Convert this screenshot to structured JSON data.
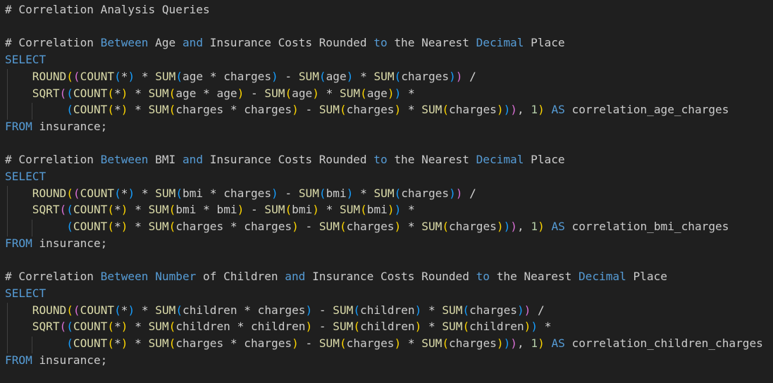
{
  "editor": {
    "language": "SQL",
    "colors": {
      "background": "#1f1f1f",
      "default": "#cccccc",
      "keyword": "#569cd6",
      "function": "#dcdcaa",
      "number": "#b5cea8",
      "bracket_level_1": "#ffd700",
      "bracket_level_2": "#da70d6",
      "bracket_level_3": "#179fff",
      "indent_guide": "#404040"
    },
    "lines": [
      [
        [
          "com",
          "# Correlation Analysis Queries"
        ]
      ],
      [],
      [
        [
          "com",
          "# Correlation "
        ],
        [
          "kw",
          "Between"
        ],
        [
          "com",
          " Age "
        ],
        [
          "kw",
          "and"
        ],
        [
          "com",
          " Insurance Costs Rounded "
        ],
        [
          "kw",
          "to"
        ],
        [
          "com",
          " the Nearest "
        ],
        [
          "kw",
          "Decimal"
        ],
        [
          "com",
          " Place"
        ]
      ],
      [
        [
          "kw",
          "SELECT"
        ]
      ],
      [
        [
          "pl",
          "    "
        ],
        [
          "fn",
          "ROUND"
        ],
        [
          "b1",
          "("
        ],
        [
          "b2",
          "("
        ],
        [
          "fn",
          "COUNT"
        ],
        [
          "b3",
          "("
        ],
        [
          "op",
          "*"
        ],
        [
          "b3",
          ")"
        ],
        [
          "op",
          " * "
        ],
        [
          "fn",
          "SUM"
        ],
        [
          "b3",
          "("
        ],
        [
          "pl",
          "age "
        ],
        [
          "op",
          "*"
        ],
        [
          "pl",
          " charges"
        ],
        [
          "b3",
          ")"
        ],
        [
          "op",
          " - "
        ],
        [
          "fn",
          "SUM"
        ],
        [
          "b3",
          "("
        ],
        [
          "pl",
          "age"
        ],
        [
          "b3",
          ")"
        ],
        [
          "op",
          " * "
        ],
        [
          "fn",
          "SUM"
        ],
        [
          "b3",
          "("
        ],
        [
          "pl",
          "charges"
        ],
        [
          "b3",
          ")"
        ],
        [
          "b2",
          ")"
        ],
        [
          "op",
          " /"
        ]
      ],
      [
        [
          "pl",
          "    "
        ],
        [
          "fn",
          "SQRT"
        ],
        [
          "b2",
          "("
        ],
        [
          "b3",
          "("
        ],
        [
          "fn",
          "COUNT"
        ],
        [
          "b1",
          "("
        ],
        [
          "op",
          "*"
        ],
        [
          "b1",
          ")"
        ],
        [
          "op",
          " * "
        ],
        [
          "fn",
          "SUM"
        ],
        [
          "b1",
          "("
        ],
        [
          "pl",
          "age "
        ],
        [
          "op",
          "*"
        ],
        [
          "pl",
          " age"
        ],
        [
          "b1",
          ")"
        ],
        [
          "op",
          " - "
        ],
        [
          "fn",
          "SUM"
        ],
        [
          "b1",
          "("
        ],
        [
          "pl",
          "age"
        ],
        [
          "b1",
          ")"
        ],
        [
          "op",
          " * "
        ],
        [
          "fn",
          "SUM"
        ],
        [
          "b1",
          "("
        ],
        [
          "pl",
          "age"
        ],
        [
          "b1",
          ")"
        ],
        [
          "b3",
          ")"
        ],
        [
          "op",
          " *"
        ]
      ],
      [
        [
          "pl",
          "         "
        ],
        [
          "b3",
          "("
        ],
        [
          "fn",
          "COUNT"
        ],
        [
          "b1",
          "("
        ],
        [
          "op",
          "*"
        ],
        [
          "b1",
          ")"
        ],
        [
          "op",
          " * "
        ],
        [
          "fn",
          "SUM"
        ],
        [
          "b1",
          "("
        ],
        [
          "pl",
          "charges "
        ],
        [
          "op",
          "*"
        ],
        [
          "pl",
          " charges"
        ],
        [
          "b1",
          ")"
        ],
        [
          "op",
          " - "
        ],
        [
          "fn",
          "SUM"
        ],
        [
          "b1",
          "("
        ],
        [
          "pl",
          "charges"
        ],
        [
          "b1",
          ")"
        ],
        [
          "op",
          " * "
        ],
        [
          "fn",
          "SUM"
        ],
        [
          "b1",
          "("
        ],
        [
          "pl",
          "charges"
        ],
        [
          "b1",
          ")"
        ],
        [
          "b3",
          ")"
        ],
        [
          "b2",
          ")"
        ],
        [
          "pl",
          ", "
        ],
        [
          "num",
          "1"
        ],
        [
          "b1",
          ")"
        ],
        [
          "pl",
          " "
        ],
        [
          "kw",
          "AS"
        ],
        [
          "pl",
          " correlation_age_charges"
        ]
      ],
      [
        [
          "kw",
          "FROM"
        ],
        [
          "pl",
          " insurance;"
        ]
      ],
      [],
      [
        [
          "com",
          "# Correlation "
        ],
        [
          "kw",
          "Between"
        ],
        [
          "com",
          " BMI "
        ],
        [
          "kw",
          "and"
        ],
        [
          "com",
          " Insurance Costs Rounded "
        ],
        [
          "kw",
          "to"
        ],
        [
          "com",
          " the Nearest "
        ],
        [
          "kw",
          "Decimal"
        ],
        [
          "com",
          " Place"
        ]
      ],
      [
        [
          "kw",
          "SELECT"
        ]
      ],
      [
        [
          "pl",
          "    "
        ],
        [
          "fn",
          "ROUND"
        ],
        [
          "b1",
          "("
        ],
        [
          "b2",
          "("
        ],
        [
          "fn",
          "COUNT"
        ],
        [
          "b3",
          "("
        ],
        [
          "op",
          "*"
        ],
        [
          "b3",
          ")"
        ],
        [
          "op",
          " * "
        ],
        [
          "fn",
          "SUM"
        ],
        [
          "b3",
          "("
        ],
        [
          "pl",
          "bmi "
        ],
        [
          "op",
          "*"
        ],
        [
          "pl",
          " charges"
        ],
        [
          "b3",
          ")"
        ],
        [
          "op",
          " - "
        ],
        [
          "fn",
          "SUM"
        ],
        [
          "b3",
          "("
        ],
        [
          "pl",
          "bmi"
        ],
        [
          "b3",
          ")"
        ],
        [
          "op",
          " * "
        ],
        [
          "fn",
          "SUM"
        ],
        [
          "b3",
          "("
        ],
        [
          "pl",
          "charges"
        ],
        [
          "b3",
          ")"
        ],
        [
          "b2",
          ")"
        ],
        [
          "op",
          " /"
        ]
      ],
      [
        [
          "pl",
          "    "
        ],
        [
          "fn",
          "SQRT"
        ],
        [
          "b2",
          "("
        ],
        [
          "b3",
          "("
        ],
        [
          "fn",
          "COUNT"
        ],
        [
          "b1",
          "("
        ],
        [
          "op",
          "*"
        ],
        [
          "b1",
          ")"
        ],
        [
          "op",
          " * "
        ],
        [
          "fn",
          "SUM"
        ],
        [
          "b1",
          "("
        ],
        [
          "pl",
          "bmi "
        ],
        [
          "op",
          "*"
        ],
        [
          "pl",
          " bmi"
        ],
        [
          "b1",
          ")"
        ],
        [
          "op",
          " - "
        ],
        [
          "fn",
          "SUM"
        ],
        [
          "b1",
          "("
        ],
        [
          "pl",
          "bmi"
        ],
        [
          "b1",
          ")"
        ],
        [
          "op",
          " * "
        ],
        [
          "fn",
          "SUM"
        ],
        [
          "b1",
          "("
        ],
        [
          "pl",
          "bmi"
        ],
        [
          "b1",
          ")"
        ],
        [
          "b3",
          ")"
        ],
        [
          "op",
          " *"
        ]
      ],
      [
        [
          "pl",
          "         "
        ],
        [
          "b3",
          "("
        ],
        [
          "fn",
          "COUNT"
        ],
        [
          "b1",
          "("
        ],
        [
          "op",
          "*"
        ],
        [
          "b1",
          ")"
        ],
        [
          "op",
          " * "
        ],
        [
          "fn",
          "SUM"
        ],
        [
          "b1",
          "("
        ],
        [
          "pl",
          "charges "
        ],
        [
          "op",
          "*"
        ],
        [
          "pl",
          " charges"
        ],
        [
          "b1",
          ")"
        ],
        [
          "op",
          " - "
        ],
        [
          "fn",
          "SUM"
        ],
        [
          "b1",
          "("
        ],
        [
          "pl",
          "charges"
        ],
        [
          "b1",
          ")"
        ],
        [
          "op",
          " * "
        ],
        [
          "fn",
          "SUM"
        ],
        [
          "b1",
          "("
        ],
        [
          "pl",
          "charges"
        ],
        [
          "b1",
          ")"
        ],
        [
          "b3",
          ")"
        ],
        [
          "b2",
          ")"
        ],
        [
          "pl",
          ", "
        ],
        [
          "num",
          "1"
        ],
        [
          "b1",
          ")"
        ],
        [
          "pl",
          " "
        ],
        [
          "kw",
          "AS"
        ],
        [
          "pl",
          " correlation_bmi_charges"
        ]
      ],
      [
        [
          "kw",
          "FROM"
        ],
        [
          "pl",
          " insurance;"
        ]
      ],
      [],
      [
        [
          "com",
          "# Correlation "
        ],
        [
          "kw",
          "Between"
        ],
        [
          "com",
          " "
        ],
        [
          "kw",
          "Number"
        ],
        [
          "com",
          " of Children "
        ],
        [
          "kw",
          "and"
        ],
        [
          "com",
          " Insurance Costs Rounded "
        ],
        [
          "kw",
          "to"
        ],
        [
          "com",
          " the Nearest "
        ],
        [
          "kw",
          "Decimal"
        ],
        [
          "com",
          " Place"
        ]
      ],
      [
        [
          "kw",
          "SELECT"
        ]
      ],
      [
        [
          "pl",
          "    "
        ],
        [
          "fn",
          "ROUND"
        ],
        [
          "b1",
          "("
        ],
        [
          "b2",
          "("
        ],
        [
          "fn",
          "COUNT"
        ],
        [
          "b3",
          "("
        ],
        [
          "op",
          "*"
        ],
        [
          "b3",
          ")"
        ],
        [
          "op",
          " * "
        ],
        [
          "fn",
          "SUM"
        ],
        [
          "b3",
          "("
        ],
        [
          "pl",
          "children "
        ],
        [
          "op",
          "*"
        ],
        [
          "pl",
          " charges"
        ],
        [
          "b3",
          ")"
        ],
        [
          "op",
          " - "
        ],
        [
          "fn",
          "SUM"
        ],
        [
          "b3",
          "("
        ],
        [
          "pl",
          "children"
        ],
        [
          "b3",
          ")"
        ],
        [
          "op",
          " * "
        ],
        [
          "fn",
          "SUM"
        ],
        [
          "b3",
          "("
        ],
        [
          "pl",
          "charges"
        ],
        [
          "b3",
          ")"
        ],
        [
          "b2",
          ")"
        ],
        [
          "op",
          " /"
        ]
      ],
      [
        [
          "pl",
          "    "
        ],
        [
          "fn",
          "SQRT"
        ],
        [
          "b2",
          "("
        ],
        [
          "b3",
          "("
        ],
        [
          "fn",
          "COUNT"
        ],
        [
          "b1",
          "("
        ],
        [
          "op",
          "*"
        ],
        [
          "b1",
          ")"
        ],
        [
          "op",
          " * "
        ],
        [
          "fn",
          "SUM"
        ],
        [
          "b1",
          "("
        ],
        [
          "pl",
          "children "
        ],
        [
          "op",
          "*"
        ],
        [
          "pl",
          " children"
        ],
        [
          "b1",
          ")"
        ],
        [
          "op",
          " - "
        ],
        [
          "fn",
          "SUM"
        ],
        [
          "b1",
          "("
        ],
        [
          "pl",
          "children"
        ],
        [
          "b1",
          ")"
        ],
        [
          "op",
          " * "
        ],
        [
          "fn",
          "SUM"
        ],
        [
          "b1",
          "("
        ],
        [
          "pl",
          "children"
        ],
        [
          "b1",
          ")"
        ],
        [
          "b3",
          ")"
        ],
        [
          "op",
          " *"
        ]
      ],
      [
        [
          "pl",
          "         "
        ],
        [
          "b3",
          "("
        ],
        [
          "fn",
          "COUNT"
        ],
        [
          "b1",
          "("
        ],
        [
          "op",
          "*"
        ],
        [
          "b1",
          ")"
        ],
        [
          "op",
          " * "
        ],
        [
          "fn",
          "SUM"
        ],
        [
          "b1",
          "("
        ],
        [
          "pl",
          "charges "
        ],
        [
          "op",
          "*"
        ],
        [
          "pl",
          " charges"
        ],
        [
          "b1",
          ")"
        ],
        [
          "op",
          " - "
        ],
        [
          "fn",
          "SUM"
        ],
        [
          "b1",
          "("
        ],
        [
          "pl",
          "charges"
        ],
        [
          "b1",
          ")"
        ],
        [
          "op",
          " * "
        ],
        [
          "fn",
          "SUM"
        ],
        [
          "b1",
          "("
        ],
        [
          "pl",
          "charges"
        ],
        [
          "b1",
          ")"
        ],
        [
          "b3",
          ")"
        ],
        [
          "b2",
          ")"
        ],
        [
          "pl",
          ", "
        ],
        [
          "num",
          "1"
        ],
        [
          "b1",
          ")"
        ],
        [
          "pl",
          " "
        ],
        [
          "kw",
          "AS"
        ],
        [
          "pl",
          " correlation_children_charges"
        ]
      ],
      [
        [
          "kw",
          "FROM"
        ],
        [
          "pl",
          " insurance;"
        ]
      ]
    ]
  }
}
